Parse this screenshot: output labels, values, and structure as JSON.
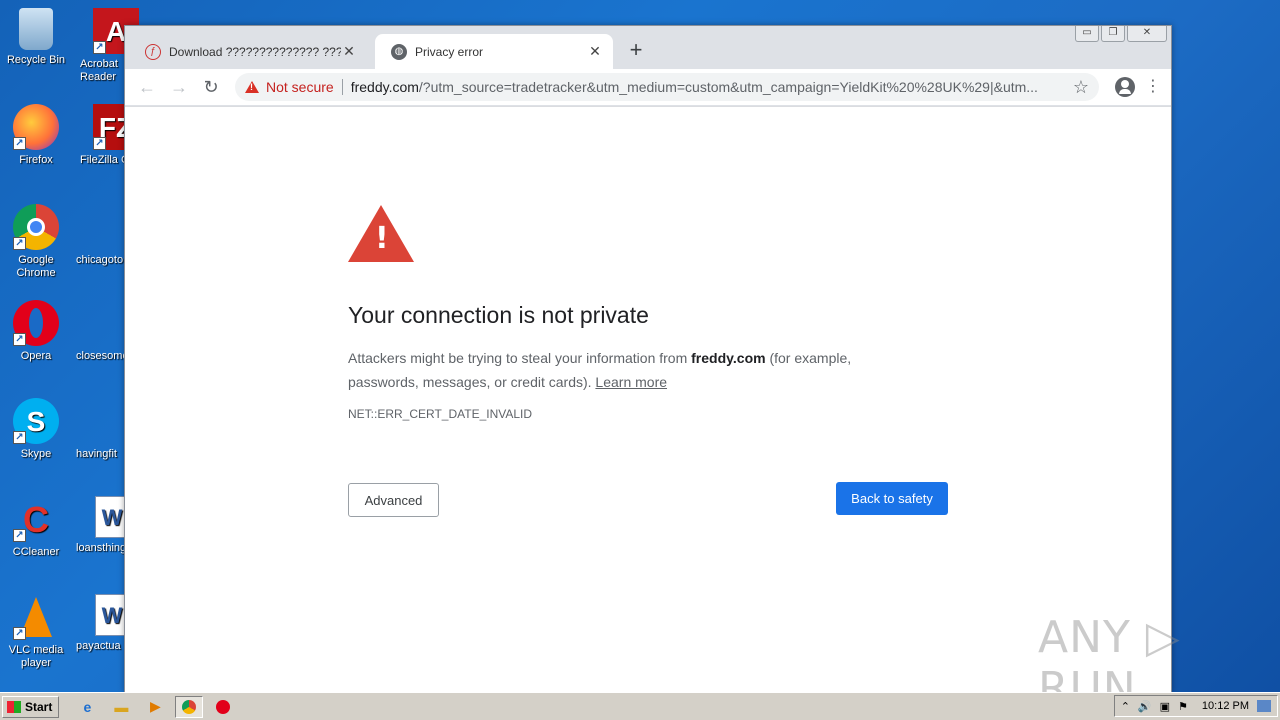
{
  "desktop": {
    "icons": [
      {
        "label": "Recycle Bin",
        "glyph": "recycle-bin-icon"
      },
      {
        "label": "Acrobat Reader",
        "glyph": "acrobat-icon"
      },
      {
        "label": "Firefox",
        "glyph": "firefox-icon"
      },
      {
        "label": "FileZilla C",
        "glyph": "filezilla-icon"
      },
      {
        "label": "Google Chrome",
        "glyph": "chrome-icon"
      },
      {
        "label": "chicagoto",
        "glyph": "file-icon"
      },
      {
        "label": "Opera",
        "glyph": "opera-icon"
      },
      {
        "label": "closesome",
        "glyph": "file-icon"
      },
      {
        "label": "Skype",
        "glyph": "skype-icon"
      },
      {
        "label": "havingfit",
        "glyph": "file-icon"
      },
      {
        "label": "CCleaner",
        "glyph": "ccleaner-icon"
      },
      {
        "label": "loansthing",
        "glyph": "word-doc-icon"
      },
      {
        "label": "VLC media player",
        "glyph": "vlc-icon"
      },
      {
        "label": "payactua",
        "glyph": "word-doc-icon"
      }
    ]
  },
  "browser": {
    "tabs": [
      {
        "title": "Download ?????????????? ??????? ???",
        "active": false
      },
      {
        "title": "Privacy error",
        "active": true
      }
    ],
    "new_tab": "+",
    "window_controls": {
      "minimize": "▭",
      "restore": "❐",
      "close": "✕"
    },
    "address": {
      "security_label": "Not secure",
      "host": "freddy.com",
      "path": "/?utm_source=tradetracker&utm_medium=custom&utm_campaign=YieldKit%20%28UK%29|&utm..."
    }
  },
  "page": {
    "heading": "Your connection is not private",
    "desc_prefix": "Attackers might be trying to steal your information from ",
    "desc_host": "freddy.com",
    "desc_suffix": " (for example, passwords, messages, or credit cards). ",
    "learn_more": "Learn more",
    "error_code": "NET::ERR_CERT_DATE_INVALID",
    "advanced_button": "Advanced",
    "safety_button": "Back to safety"
  },
  "watermark": "ANY ▷ RUN",
  "taskbar": {
    "start": "Start",
    "clock": "10:12 PM"
  },
  "colors": {
    "error_red": "#db4437",
    "primary_blue": "#1a73e8",
    "not_secure_red": "#c5221f"
  }
}
